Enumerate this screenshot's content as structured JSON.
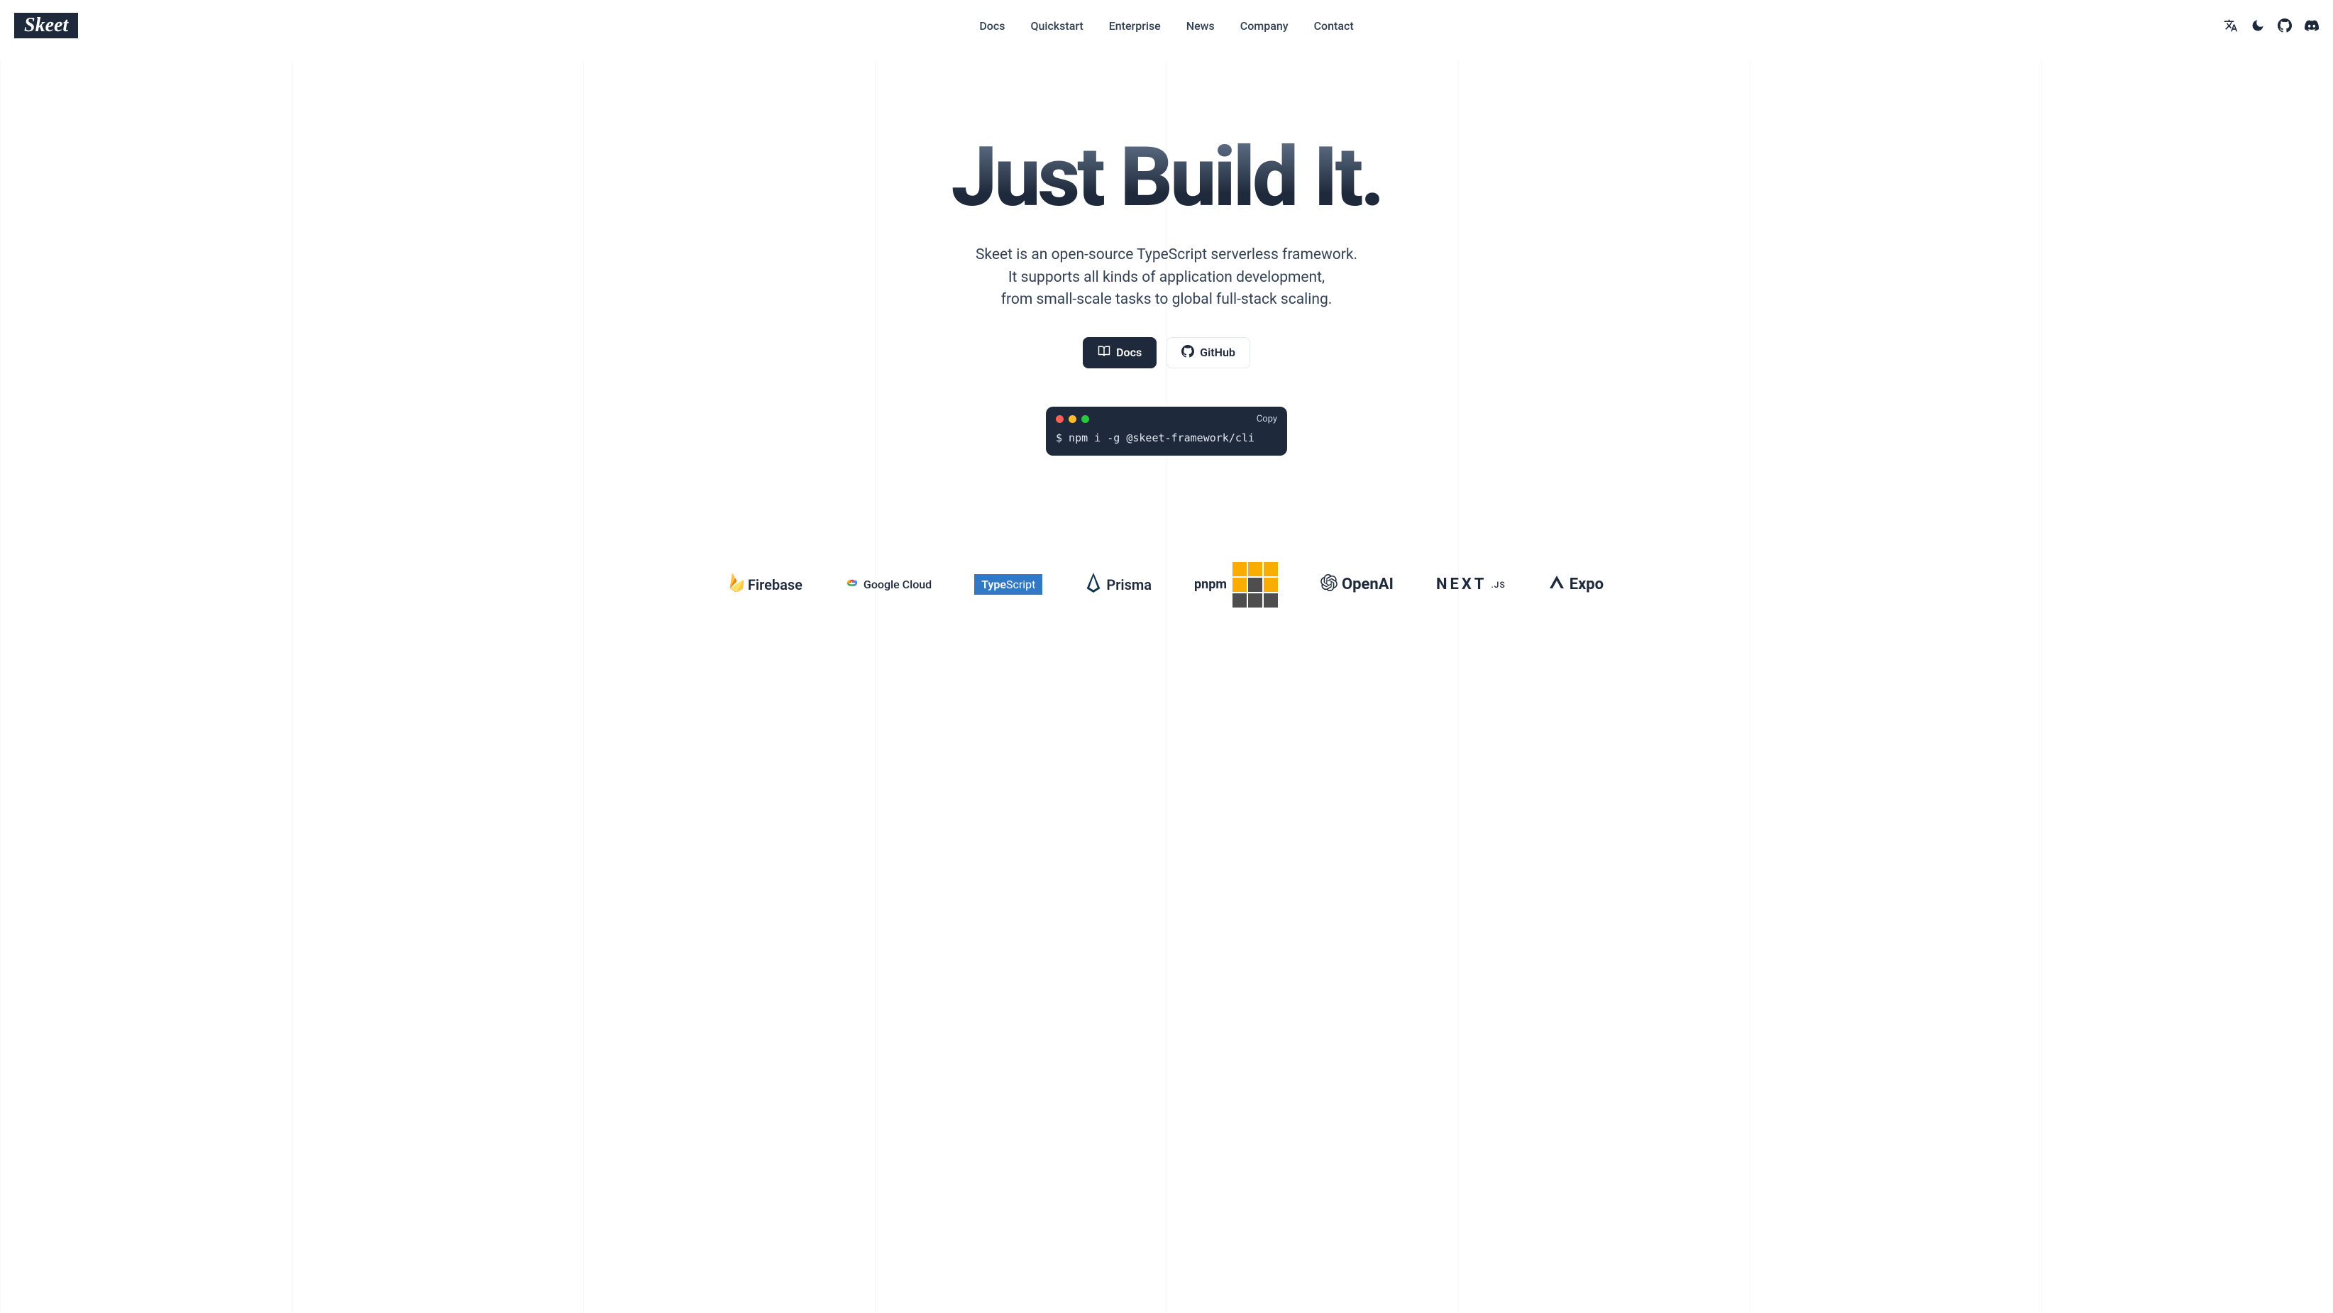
{
  "logo": "Skeet",
  "nav": {
    "docs": "Docs",
    "quickstart": "Quickstart",
    "enterprise": "Enterprise",
    "news": "News",
    "company": "Company",
    "contact": "Contact"
  },
  "hero": {
    "title": "Just Build It.",
    "subtitle_line1": "Skeet is an open-source TypeScript serverless framework.",
    "subtitle_line2": "It supports all kinds of application development,",
    "subtitle_line3": "from small-scale tasks to global full-stack scaling.",
    "cta_docs": "Docs",
    "cta_github": "GitHub"
  },
  "terminal": {
    "copy_label": "Copy",
    "command": "$ npm i -g @skeet-framework/cli"
  },
  "tech_logos": {
    "firebase": "Firebase",
    "google_cloud": "Google Cloud",
    "typescript_prefix": "Type",
    "typescript_suffix": "Script",
    "prisma": "Prisma",
    "pnpm": "pnpm",
    "openai": "OpenAI",
    "next_prefix": "NEXT",
    "next_suffix": ".JS",
    "expo": "Expo"
  }
}
